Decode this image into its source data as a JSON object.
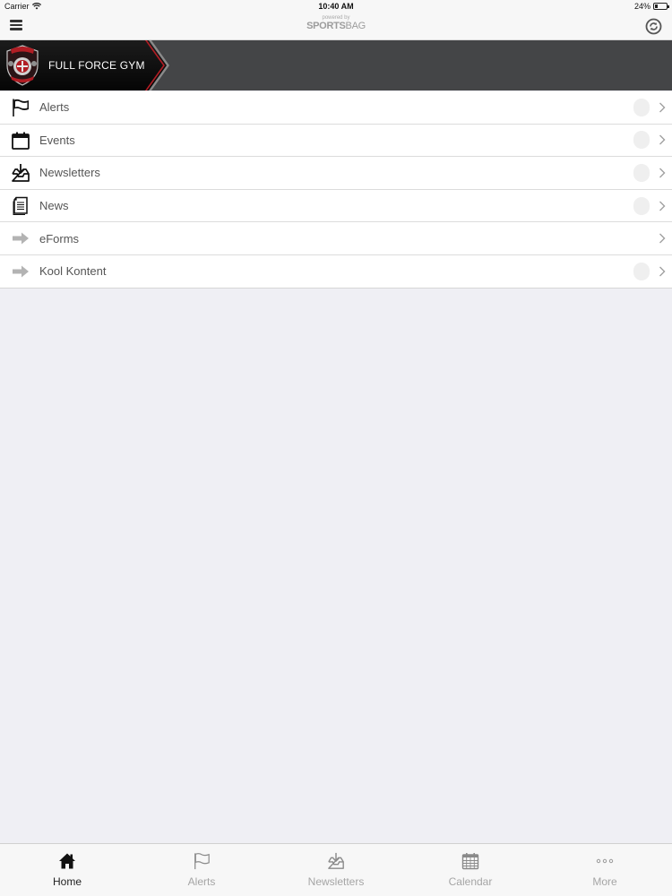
{
  "status_bar": {
    "carrier": "Carrier",
    "time": "10:40 AM",
    "battery": "24%",
    "battery_level": 0.24
  },
  "nav_bar": {
    "powered_small": "powered by",
    "brand_bold": "SPORTS",
    "brand_thin": "BAG"
  },
  "banner": {
    "title": "FULL FORCE GYM"
  },
  "menu": [
    {
      "label": "Alerts",
      "icon": "flag-icon",
      "badge": true
    },
    {
      "label": "Events",
      "icon": "calendar-icon",
      "badge": true
    },
    {
      "label": "Newsletters",
      "icon": "inbox-download-icon",
      "badge": true
    },
    {
      "label": "News",
      "icon": "document-icon",
      "badge": true
    },
    {
      "label": "eForms",
      "icon": "arrow-right-icon",
      "badge": false
    },
    {
      "label": "Kool Kontent",
      "icon": "arrow-right-icon",
      "badge": true
    }
  ],
  "tabs": [
    {
      "label": "Home",
      "icon": "home-icon",
      "active": true
    },
    {
      "label": "Alerts",
      "icon": "flag-icon",
      "active": false
    },
    {
      "label": "Newsletters",
      "icon": "inbox-download-icon",
      "active": false
    },
    {
      "label": "Calendar",
      "icon": "calendar-grid-icon",
      "active": false
    },
    {
      "label": "More",
      "icon": "more-dots-icon",
      "active": false
    }
  ],
  "colors": {
    "banner_bg": "#444547",
    "banner_accent": "#b11d24",
    "background": "#efeff4"
  }
}
